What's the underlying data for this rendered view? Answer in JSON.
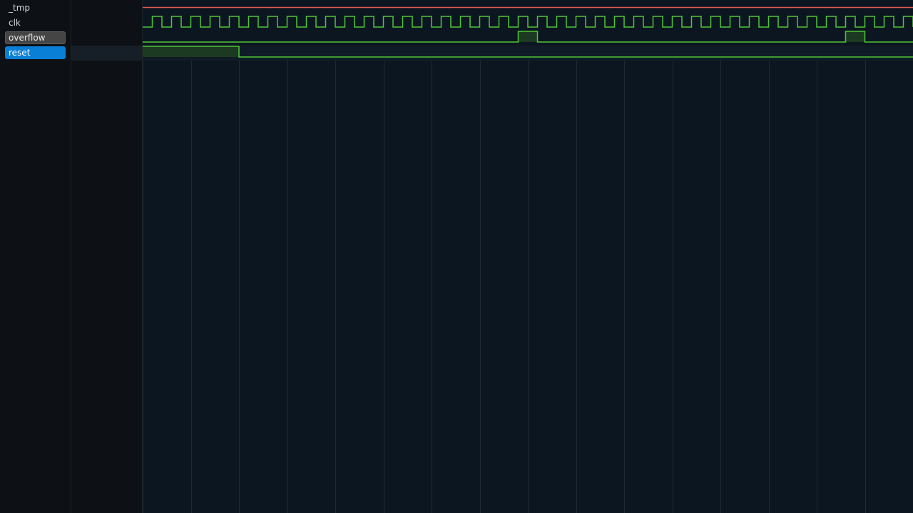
{
  "colors": {
    "background": "#0c1620",
    "panel_background": "#0d1115",
    "grid_line": "#1f2a33",
    "wave_green": "#4ec537",
    "wave_fill": "#1c3a22",
    "undefined_red": "#e05a5a",
    "selection_blue": "#0a7fd6",
    "hover_gray": "#454545"
  },
  "signals": [
    {
      "name": "_tmp",
      "state": "normal",
      "kind": "undefined"
    },
    {
      "name": "clk",
      "state": "normal",
      "kind": "clock"
    },
    {
      "name": "overflow",
      "state": "hovered",
      "kind": "bit"
    },
    {
      "name": "reset",
      "state": "selected",
      "kind": "bit"
    }
  ],
  "waveforms": {
    "clk": {
      "period_ticks": 2,
      "total_ticks": 80,
      "first_edge": "rise"
    },
    "overflow": {
      "high_ticks": [
        [
          39,
          41
        ],
        [
          73,
          75
        ]
      ]
    },
    "reset": {
      "high_ticks": [
        [
          0,
          10
        ]
      ]
    }
  },
  "timeline": {
    "total_ticks": 80,
    "grid_every_ticks": 5
  }
}
